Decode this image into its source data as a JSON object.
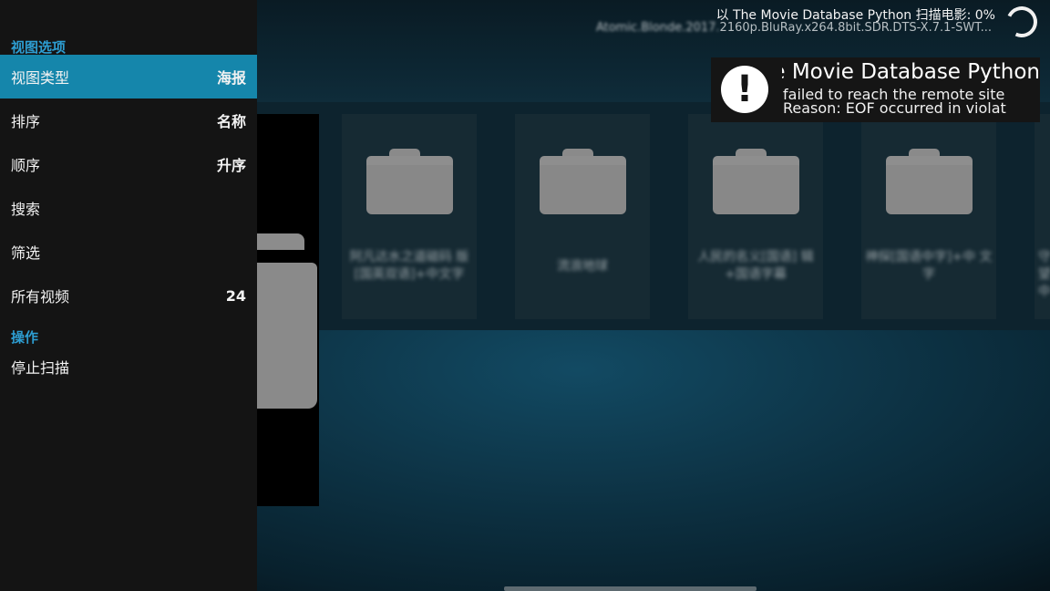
{
  "sidebar": {
    "view_options_label": "视图选项",
    "actions_label": "操作",
    "items": [
      {
        "label": "视图类型",
        "value": "海报",
        "selected": true
      },
      {
        "label": "排序",
        "value": "名称",
        "selected": false
      },
      {
        "label": "顺序",
        "value": "升序",
        "selected": false
      },
      {
        "label": "搜索",
        "value": "",
        "selected": false
      },
      {
        "label": "筛选",
        "value": "",
        "selected": false
      },
      {
        "label": "所有视频",
        "value": "24",
        "selected": false
      }
    ],
    "actions": [
      {
        "label": "停止扫描"
      }
    ]
  },
  "status": {
    "scan_text": "以 The Movie Database Python 扫描电影: 0%",
    "file_text_blurred": "Atomic.Blonde.2017.",
    "file_text": "2160p.BluRay.x264.8bit.SDR.DTS-X.7.1-SWT..."
  },
  "toast": {
    "icon": "exclamation-icon",
    "title": "The Movie Database Python",
    "line1": "failed to reach the remote site",
    "line2": "Reason: EOF occurred in violat"
  },
  "folders": [
    {
      "title": "阿凡达水之道磁码 版[国英双语]+中文字"
    },
    {
      "title": "流浪地球"
    },
    {
      "title": "人民的名义[国语] 辑+国语字幕"
    },
    {
      "title": "神探[国语中字]+中 文字"
    },
    {
      "title": "守望 中"
    }
  ],
  "colors": {
    "accent": "#1586ab",
    "section_label": "#2d9dd1",
    "sidebar_bg": "#141414"
  }
}
